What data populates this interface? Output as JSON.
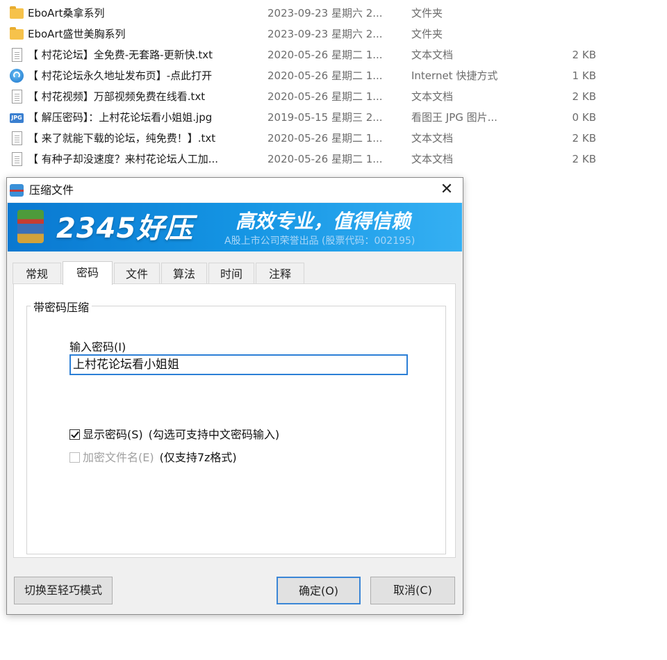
{
  "files": [
    {
      "icon": "folder-icon",
      "name": "EboArt桑拿系列",
      "date": "2023-09-23 星期六 2...",
      "type": "文件夹",
      "size": ""
    },
    {
      "icon": "folder-icon",
      "name": "EboArt盛世美胸系列",
      "date": "2023-09-23 星期六 2...",
      "type": "文件夹",
      "size": ""
    },
    {
      "icon": "text-file-icon",
      "name": "【 村花论坛】全免费-无套路-更新快.txt",
      "date": "2020-05-26 星期二 1...",
      "type": "文本文档",
      "size": "2 KB"
    },
    {
      "icon": "internet-shortcut-icon",
      "name": "【 村花论坛永久地址发布页】-点此打开",
      "date": "2020-05-26 星期二 1...",
      "type": "Internet 快捷方式",
      "size": "1 KB"
    },
    {
      "icon": "text-file-icon",
      "name": "【 村花视频】万部视频免费在线看.txt",
      "date": "2020-05-26 星期二 1...",
      "type": "文本文档",
      "size": "2 KB"
    },
    {
      "icon": "jpg-image-icon",
      "name": "【 解压密码】：上村花论坛看小姐姐.jpg",
      "date": "2019-05-15 星期三 2...",
      "type": "看图王 JPG 图片...",
      "size": "0 KB"
    },
    {
      "icon": "text-file-icon",
      "name": "【 来了就能下载的论坛，纯免费！】.txt",
      "date": "2020-05-26 星期二 1...",
      "type": "文本文档",
      "size": "2 KB"
    },
    {
      "icon": "text-file-icon",
      "name": "【 有种子却没速度？来村花论坛人工加...",
      "date": "2020-05-26 星期二 1...",
      "type": "文本文档",
      "size": "2 KB"
    }
  ],
  "dialog": {
    "title": "压缩文件",
    "close_glyph": "✕",
    "banner": {
      "brand": "2345好压",
      "slogan": "高效专业，值得信赖",
      "subtitle": "A股上市公司荣誉出品 (股票代码：002195)"
    },
    "tabs": [
      "常规",
      "密码",
      "文件",
      "算法",
      "时间",
      "注释"
    ],
    "active_tab": "密码",
    "group_title": "带密码压缩",
    "password_label": "输入密码(I)",
    "password_value": "上村花论坛看小姐姐",
    "show_password": {
      "label": "显示密码(S)",
      "note": "(勾选可支持中文密码输入)",
      "checked": true
    },
    "encrypt_names": {
      "label": "加密文件名(E)",
      "note": "(仅支持7z格式)",
      "checked": false,
      "disabled": true
    },
    "buttons": {
      "mode": "切换至轻巧模式",
      "ok": "确定(O)",
      "cancel": "取消(C)"
    }
  },
  "colors": {
    "banner": "#1494e3",
    "input_border": "#2c7fd6",
    "folder": "#f6c24b"
  }
}
